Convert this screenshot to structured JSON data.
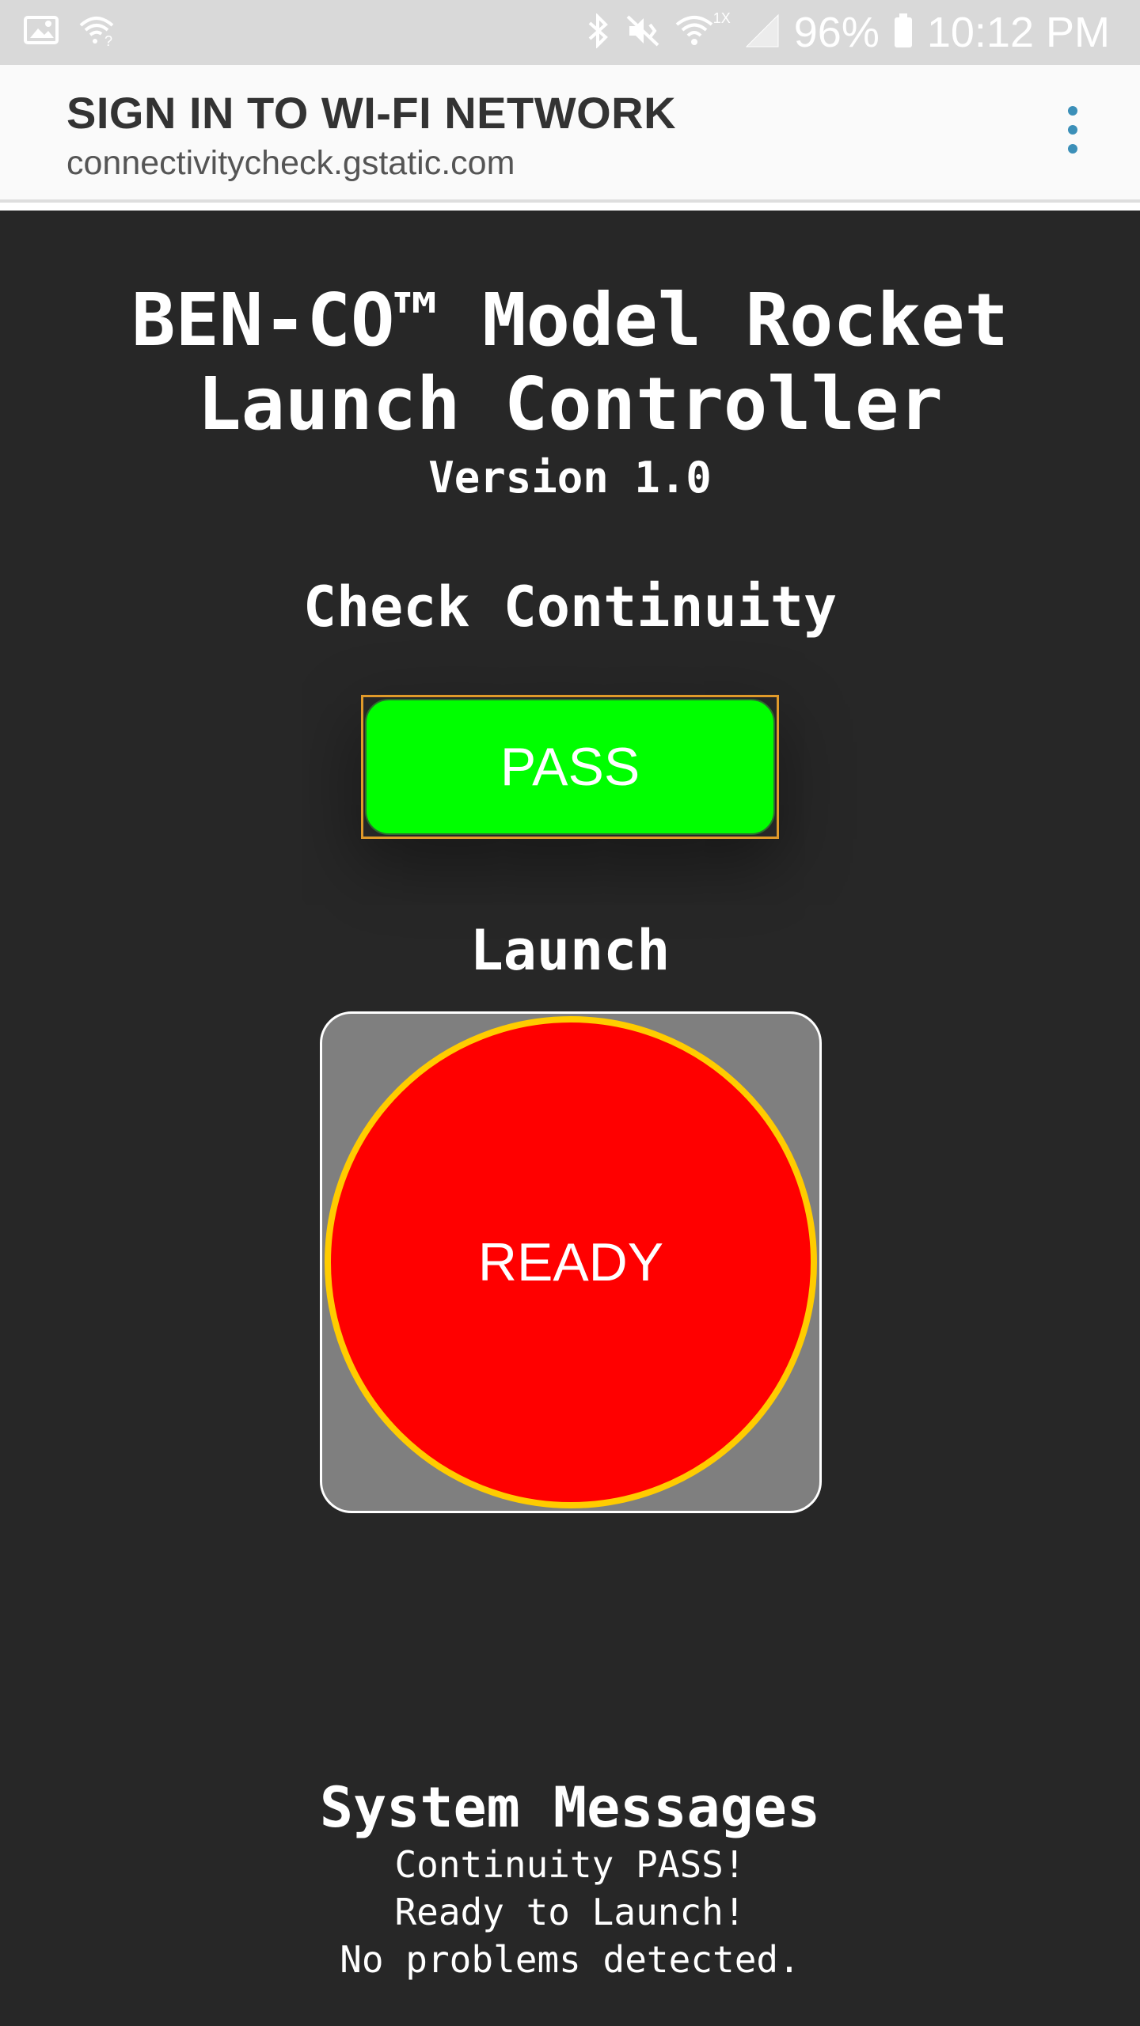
{
  "status_bar": {
    "icons": [
      "image-icon",
      "wifi-question-icon",
      "bluetooth-icon",
      "mute-vibrate-icon",
      "wifi-icon",
      "signal-icon",
      "battery-icon"
    ],
    "network_type": "1X",
    "battery": "96%",
    "time": "10:12 PM"
  },
  "appbar": {
    "title": "SIGN IN TO WI-FI NETWORK",
    "url": "connectivitycheck.gstatic.com",
    "menu_icon": "more-vert-icon",
    "accent_color": "#3b8fb8"
  },
  "page": {
    "title_line1": "BEN-CO™ Model Rocket",
    "title_line2": "Launch Controller",
    "version": "Version 1.0",
    "continuity_heading": "Check Continuity",
    "continuity_button": "PASS",
    "continuity_color": "#00ff00",
    "launch_heading": "Launch",
    "launch_button": "READY",
    "launch_color": "#ff0000",
    "launch_ring_color": "#ffcc00",
    "messages_heading": "System Messages",
    "messages": [
      "Continuity PASS!",
      "Ready to Launch!",
      "No problems detected."
    ]
  }
}
